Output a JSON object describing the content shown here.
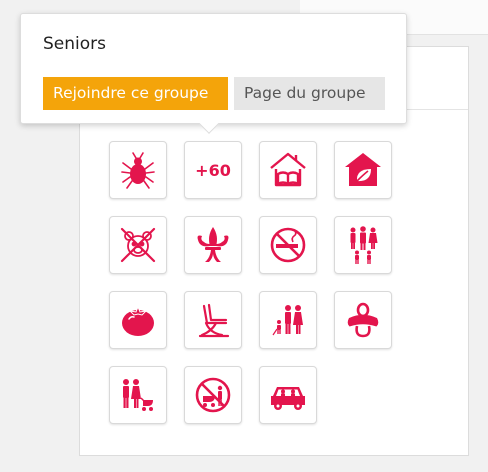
{
  "tooltip": {
    "title": "Seniors",
    "join_button": "Rejoindre ce groupe",
    "page_button": "Page du groupe"
  },
  "accent_color": "#e3154d",
  "join_color": "#f4a40a",
  "groups": [
    {
      "icon": "mite-icon"
    },
    {
      "icon": "plus-60-icon",
      "label": "+60"
    },
    {
      "icon": "house-book-icon"
    },
    {
      "icon": "eco-house-icon"
    },
    {
      "icon": "no-pets-icon"
    },
    {
      "icon": "scout-fleur-de-lis-icon"
    },
    {
      "icon": "no-smoking-icon"
    },
    {
      "icon": "family-icon"
    },
    {
      "icon": "tomato-icon"
    },
    {
      "icon": "lounge-chair-icon"
    },
    {
      "icon": "adults-child-icon"
    },
    {
      "icon": "pacifier-icon"
    },
    {
      "icon": "parents-stroller-icon"
    },
    {
      "icon": "no-stroller-icon"
    },
    {
      "icon": "car-family-icon"
    }
  ]
}
